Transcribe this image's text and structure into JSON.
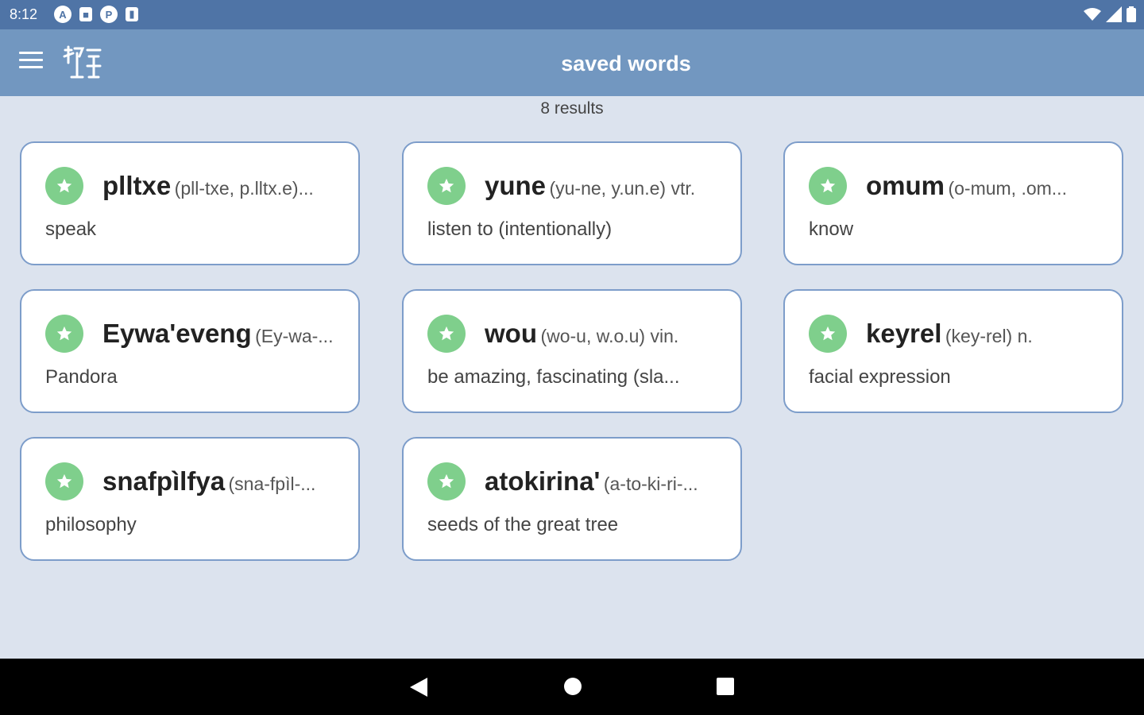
{
  "status_bar": {
    "time": "8:12",
    "left_icons": [
      "A",
      "■",
      "P",
      "▮"
    ]
  },
  "app_bar": {
    "title": "saved words",
    "menu_icon": "hamburger-menu-icon",
    "logo_icon": "reykunyu-logo-icon"
  },
  "results_text": "8 results",
  "colors": {
    "status_bar": "#4f74a6",
    "app_bar": "#7297c0",
    "background": "#dce3ee",
    "card_border": "#7d9dca",
    "star": "#7fcf8c"
  },
  "cards": [
    {
      "word": "plltxe",
      "pron": "(pll-txe, p.lltx.e)...",
      "definition": "speak"
    },
    {
      "word": "yune",
      "pron": "(yu-ne, y.un.e) vtr.",
      "definition": "listen to (intentionally)"
    },
    {
      "word": "omum",
      "pron": "(o-mum, .om...",
      "definition": "know"
    },
    {
      "word": "Eywa'eveng",
      "pron": "(Ey-wa-...",
      "definition": "Pandora"
    },
    {
      "word": "wou",
      "pron": "(wo-u, w.o.u) vin.",
      "definition": "be amazing, fascinating (sla..."
    },
    {
      "word": "keyrel",
      "pron": "(key-rel) n.",
      "definition": "facial expression"
    },
    {
      "word": "snafpìlfya",
      "pron": "(sna-fpìl-...",
      "definition": "philosophy"
    },
    {
      "word": "atokirina'",
      "pron": "(a-to-ki-ri-...",
      "definition": "seeds of the great tree"
    }
  ]
}
